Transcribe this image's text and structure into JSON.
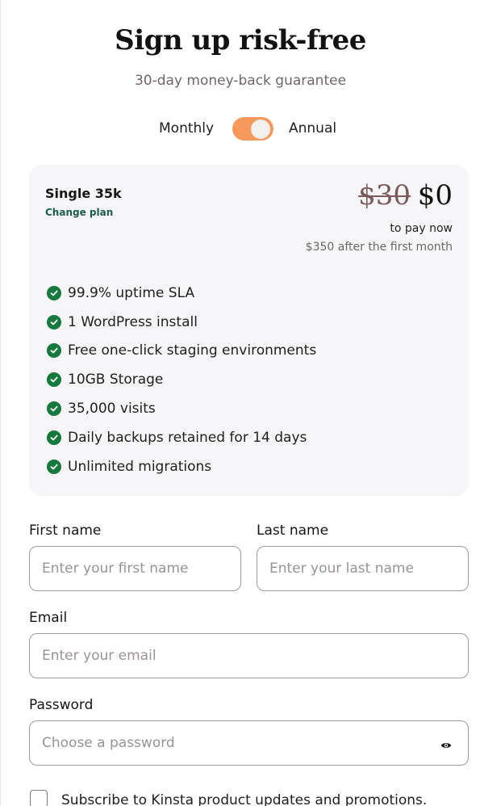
{
  "header": {
    "title": "Sign up risk-free",
    "subtitle": "30-day money-back guarantee"
  },
  "billing_toggle": {
    "left_label": "Monthly",
    "right_label": "Annual",
    "selected": "Annual",
    "accent_color": "#f59a5c"
  },
  "plan": {
    "name": "Single 35k",
    "change_link": "Change plan",
    "old_price": "$30",
    "new_price": "$0",
    "pay_note": "to pay now",
    "after_note": "$350 after the first month",
    "check_color": "#167a3e",
    "features": [
      "99.9% uptime SLA",
      "1 WordPress install",
      "Free one-click staging environments",
      "10GB Storage",
      "35,000 visits",
      "Daily backups retained for 14 days",
      "Unlimited migrations"
    ]
  },
  "form": {
    "first_name": {
      "label": "First name",
      "placeholder": "Enter your first name",
      "value": ""
    },
    "last_name": {
      "label": "Last name",
      "placeholder": "Enter your last name",
      "value": ""
    },
    "email": {
      "label": "Email",
      "placeholder": "Enter your email",
      "value": ""
    },
    "password": {
      "label": "Password",
      "placeholder": "Choose a password",
      "value": "",
      "toggle_icon": "eye-icon"
    },
    "subscribe": {
      "label": "Subscribe to Kinsta product updates and promotions.",
      "checked": false
    }
  }
}
